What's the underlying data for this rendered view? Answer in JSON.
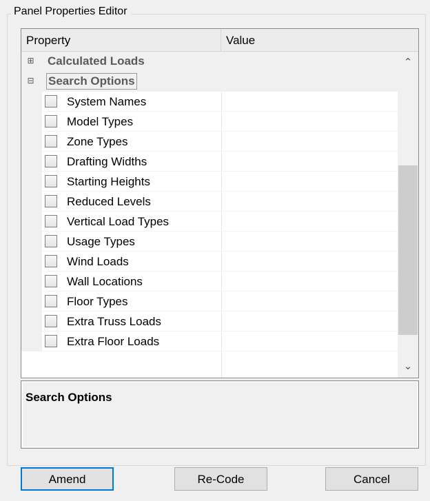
{
  "window": {
    "group_title": "Panel Properties Editor"
  },
  "grid": {
    "header": {
      "property": "Property",
      "value": "Value"
    },
    "categories": [
      {
        "toggle": "⊞",
        "label": "Calculated Loads"
      },
      {
        "toggle": "⊟",
        "label": "Search Options"
      }
    ],
    "items": [
      {
        "label": "System Names",
        "checked": false
      },
      {
        "label": "Model Types",
        "checked": false
      },
      {
        "label": "Zone Types",
        "checked": false
      },
      {
        "label": "Drafting Widths",
        "checked": false
      },
      {
        "label": "Starting Heights",
        "checked": false
      },
      {
        "label": "Reduced Levels",
        "checked": false
      },
      {
        "label": "Vertical Load Types",
        "checked": false
      },
      {
        "label": "Usage Types",
        "checked": false
      },
      {
        "label": "Wind Loads",
        "checked": false
      },
      {
        "label": "Wall Locations",
        "checked": false
      },
      {
        "label": "Floor Types",
        "checked": false
      },
      {
        "label": "Extra Truss Loads",
        "checked": false
      },
      {
        "label": "Extra Floor Loads",
        "checked": false
      }
    ],
    "scrollbar": {
      "up_icon": "chevron-up-icon",
      "down_icon": "chevron-down-icon",
      "up_glyph": "⌃",
      "down_glyph": "⌄"
    }
  },
  "description": {
    "title": "Search Options"
  },
  "buttons": {
    "amend": "Amend",
    "recode": "Re-Code",
    "cancel": "Cancel"
  },
  "colors": {
    "accent": "#0078d7",
    "category_text": "#5a5a5a"
  }
}
